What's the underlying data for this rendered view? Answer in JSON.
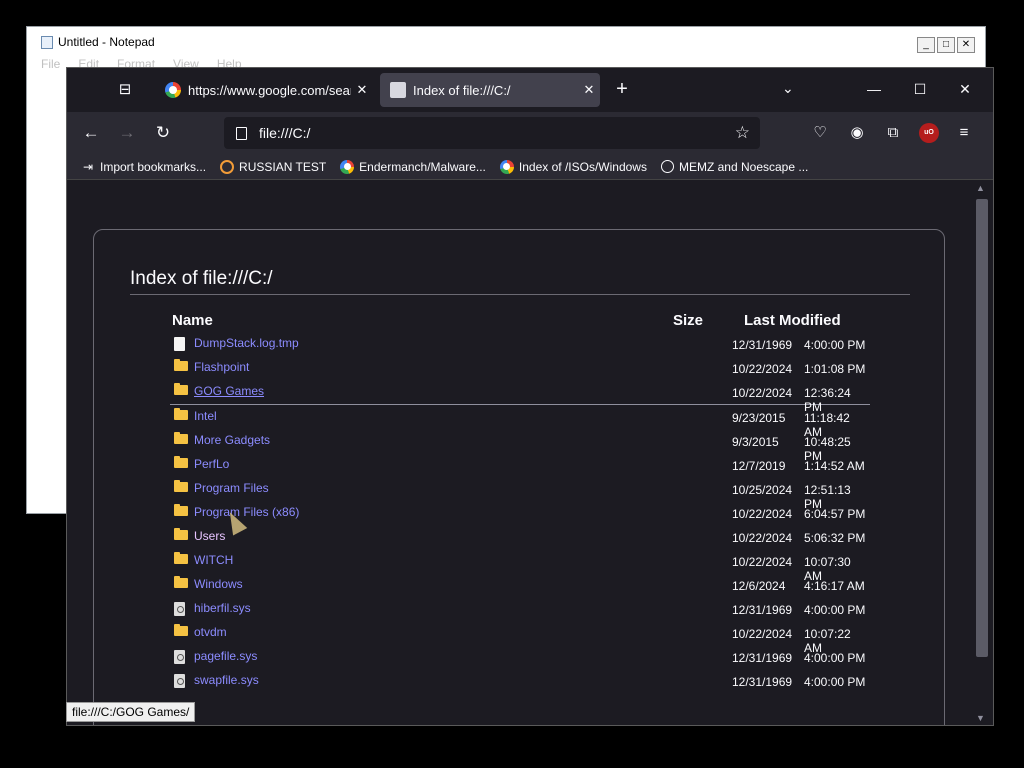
{
  "notepad": {
    "title": "Untitled - Notepad",
    "menu": [
      "File",
      "Edit",
      "Format",
      "View",
      "Help"
    ],
    "controls": {
      "minimize": "_",
      "maximize": "□",
      "close": "✕"
    }
  },
  "browser": {
    "tabs": [
      {
        "title": "https://www.google.com/searc",
        "close": "✕",
        "active": false
      },
      {
        "title": "Index of file:///C:/",
        "close": "✕",
        "active": true
      }
    ],
    "new_tab": "+",
    "window_controls": {
      "minimize": "—",
      "maximize": "☐",
      "close": "✕"
    },
    "url": "file:///C:/",
    "bookmarks": [
      {
        "label": "Import bookmarks...",
        "icon": "import-icon"
      },
      {
        "label": "RUSSIAN TEST",
        "icon": "search-icon"
      },
      {
        "label": "Endermanch/Malware...",
        "icon": "google-icon"
      },
      {
        "label": "Index of /ISOs/Windows",
        "icon": "google-icon"
      },
      {
        "label": "MEMZ and Noescape ...",
        "icon": "globe-icon"
      }
    ],
    "ublock_label": "uO"
  },
  "listing": {
    "heading": "Index of file:///C:/",
    "columns": {
      "name": "Name",
      "size": "Size",
      "modified": "Last Modified"
    },
    "rows": [
      {
        "name": "DumpStack.log.tmp",
        "type": "file",
        "date": "12/31/1969",
        "time": "4:00:00 PM"
      },
      {
        "name": "Flashpoint",
        "type": "folder",
        "date": "10/22/2024",
        "time": "1:01:08 PM"
      },
      {
        "name": "GOG Games",
        "type": "folder",
        "date": "10/22/2024",
        "time": "12:36:24 PM"
      },
      {
        "name": "Intel",
        "type": "folder",
        "date": "9/23/2015",
        "time": "11:18:42 AM"
      },
      {
        "name": "More Gadgets",
        "type": "folder",
        "date": "9/3/2015",
        "time": "10:48:25 PM"
      },
      {
        "name": "PerfLo",
        "type": "folder",
        "date": "12/7/2019",
        "time": "1:14:52 AM"
      },
      {
        "name": "Program Files",
        "type": "folder",
        "date": "10/25/2024",
        "time": "12:51:13 PM"
      },
      {
        "name": "Program Files (x86)",
        "type": "folder",
        "date": "10/22/2024",
        "time": "6:04:57 PM"
      },
      {
        "name": "Users",
        "type": "folder",
        "date": "10/22/2024",
        "time": "5:06:32 PM"
      },
      {
        "name": "WITCH",
        "type": "folder",
        "date": "10/22/2024",
        "time": "10:07:30 AM"
      },
      {
        "name": "Windows",
        "type": "folder",
        "date": "12/6/2024",
        "time": "4:16:17 AM"
      },
      {
        "name": "hiberfil.sys",
        "type": "sysfile",
        "date": "12/31/1969",
        "time": "4:00:00 PM"
      },
      {
        "name": "otvdm",
        "type": "folder",
        "date": "10/22/2024",
        "time": "10:07:22 AM"
      },
      {
        "name": "pagefile.sys",
        "type": "sysfile",
        "date": "12/31/1969",
        "time": "4:00:00 PM"
      },
      {
        "name": "swapfile.sys",
        "type": "sysfile",
        "date": "12/31/1969",
        "time": "4:00:00 PM"
      }
    ]
  },
  "status_url": "file:///C:/GOG Games/"
}
